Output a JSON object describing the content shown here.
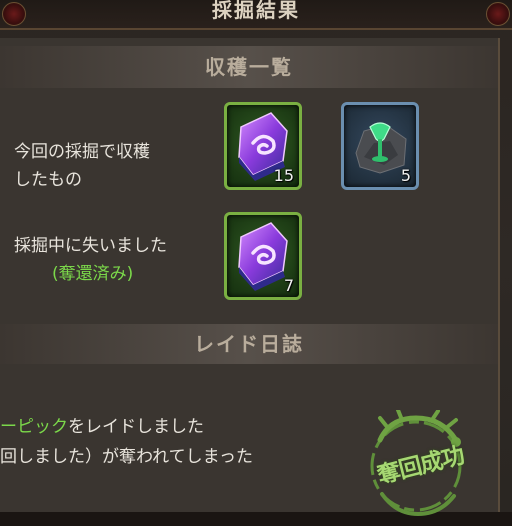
{
  "title": "採掘結果",
  "harvest": {
    "header": "収穫一覧",
    "harvested_label_line1": "今回の採掘で収穫",
    "harvested_label_line2": "したもの",
    "harvested_items": [
      {
        "icon": "purple-crystal-icon",
        "count": "15",
        "rarity_color": "#7ab042"
      },
      {
        "icon": "green-ore-icon",
        "count": "5",
        "rarity_color": "#6b8fb0"
      }
    ],
    "lost_label": "採掘中に失いました",
    "lost_note": "(奪還済み)",
    "lost_items": [
      {
        "icon": "purple-crystal-icon",
        "count": "7",
        "rarity_color": "#7ab042"
      }
    ]
  },
  "raid_log": {
    "header": "レイド日誌",
    "line1_name": "ーピック",
    "line1_rest": "をレイドしました",
    "line2": "回しました）が奪われてしまった"
  },
  "stamp": {
    "text": "奪回成功",
    "color": "#a6d872"
  },
  "colors": {
    "highlight_green": "#7bd84a",
    "panel_bg": "#3a3530"
  }
}
